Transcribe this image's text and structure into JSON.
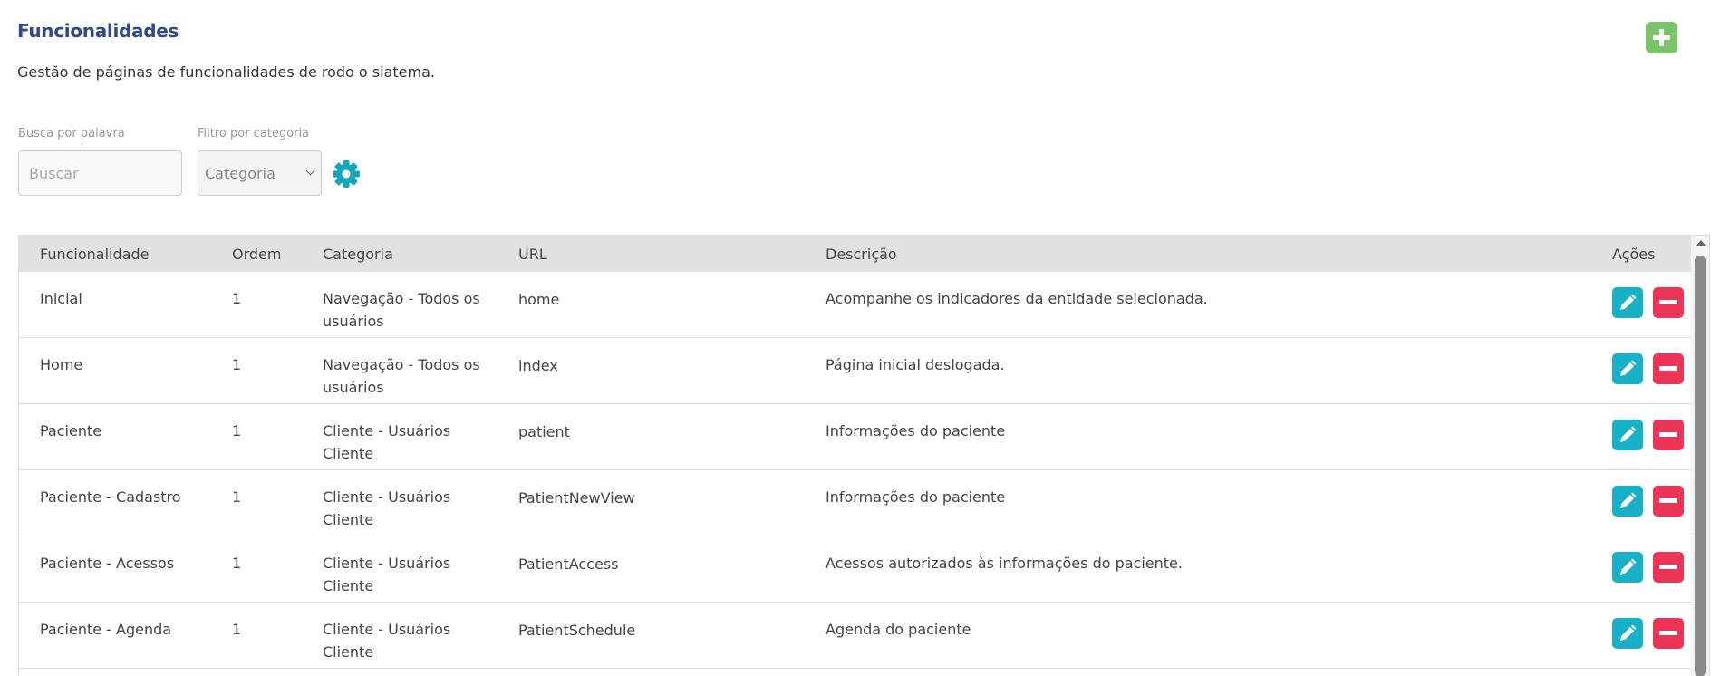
{
  "header": {
    "title": "Funcionalidades",
    "subtitle": "Gestão de páginas de funcionalidades de rodo o siatema."
  },
  "filters": {
    "search_label": "Busca por palavra",
    "search_placeholder": "Buscar",
    "search_value": "",
    "category_label": "Filtro por categoria",
    "category_selected": "Categoria"
  },
  "colors": {
    "title": "#2e4a8c",
    "add_button": "#7cc26a",
    "edit_button": "#17b0c6",
    "delete_button": "#ec3457",
    "gear": "#17a7bd"
  },
  "icons": {
    "add": "plus-icon",
    "settings": "gear-icon",
    "edit": "pencil-icon",
    "delete": "minus-icon"
  },
  "table": {
    "columns": [
      "Funcionalidade",
      "Ordem",
      "Categoria",
      "URL",
      "Descrição",
      "Ações"
    ],
    "rows": [
      {
        "funcionalidade": "Inicial",
        "ordem": "1",
        "categoria": "Navegação - Todos os usuários",
        "url": "home",
        "descricao": "Acompanhe os indicadores da entidade selecionada."
      },
      {
        "funcionalidade": "Home",
        "ordem": "1",
        "categoria": "Navegação - Todos os usuários",
        "url": "index",
        "descricao": "Página inicial deslogada."
      },
      {
        "funcionalidade": "Paciente",
        "ordem": "1",
        "categoria": "Cliente - Usuários Cliente",
        "url": "patient",
        "descricao": "Informações do paciente"
      },
      {
        "funcionalidade": "Paciente - Cadastro",
        "ordem": "1",
        "categoria": "Cliente - Usuários Cliente",
        "url": "PatientNewView",
        "descricao": "Informações do paciente"
      },
      {
        "funcionalidade": "Paciente - Acessos",
        "ordem": "1",
        "categoria": "Cliente - Usuários Cliente",
        "url": "PatientAccess",
        "descricao": "Acessos autorizados às informações do paciente."
      },
      {
        "funcionalidade": "Paciente - Agenda",
        "ordem": "1",
        "categoria": "Cliente - Usuários Cliente",
        "url": "PatientSchedule",
        "descricao": "Agenda do paciente"
      }
    ]
  }
}
